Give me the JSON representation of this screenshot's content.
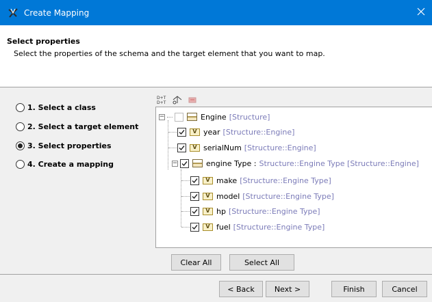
{
  "window": {
    "title": "Create Mapping"
  },
  "header": {
    "title": "Select properties",
    "description": "Select the properties of the schema and the target element that you want to map."
  },
  "steps": [
    {
      "label": "1. Select a class",
      "selected": false
    },
    {
      "label": "2. Select a target element",
      "selected": false
    },
    {
      "label": "3. Select properties",
      "selected": true
    },
    {
      "label": "4. Create a mapping",
      "selected": false
    }
  ],
  "toolbar": {
    "icons": [
      "sort-icon",
      "move-up-icon",
      "move-down-icon"
    ]
  },
  "tree": [
    {
      "name": "Engine",
      "type": "[Structure]",
      "checked": false,
      "enabled": false,
      "icon": "structure"
    },
    {
      "name": "year",
      "type": "[Structure::Engine]",
      "checked": true,
      "icon": "property",
      "icon_text": "V"
    },
    {
      "name": "serialNum",
      "type": "[Structure::Engine]",
      "checked": true,
      "icon": "property",
      "icon_text": "V"
    },
    {
      "name": "engine Type :",
      "type": "Structure::Engine Type [Structure::Engine]",
      "checked": true,
      "icon": "structure"
    },
    {
      "name": "make",
      "type": "[Structure::Engine Type]",
      "checked": true,
      "icon": "property",
      "icon_text": "V"
    },
    {
      "name": "model",
      "type": "[Structure::Engine Type]",
      "checked": true,
      "icon": "property",
      "icon_text": "V"
    },
    {
      "name": "hp",
      "type": "[Structure::Engine Type]",
      "checked": true,
      "icon": "property",
      "icon_text": "V"
    },
    {
      "name": "fuel",
      "type": "[Structure::Engine Type]",
      "checked": true,
      "icon": "property",
      "icon_text": "V"
    }
  ],
  "buttons": {
    "clear_all": "Clear All",
    "select_all": "Select All",
    "back": "< Back",
    "next": "Next >",
    "finish": "Finish",
    "cancel": "Cancel"
  }
}
